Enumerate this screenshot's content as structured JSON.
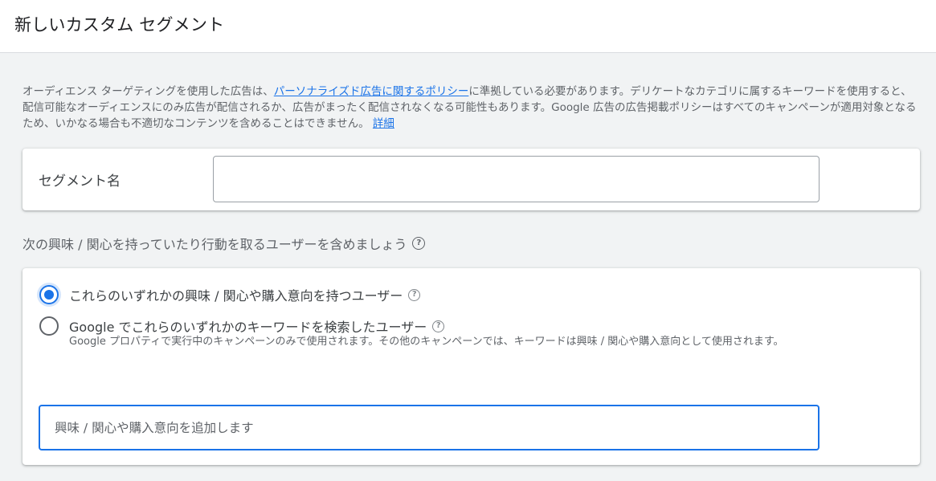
{
  "header": {
    "title": "新しいカスタム セグメント"
  },
  "policy": {
    "text_before": "オーディエンス ターゲティングを使用した広告は、",
    "link_policy": "パーソナライズド広告に関するポリシー",
    "text_after": "に準拠している必要があります。デリケートなカテゴリに属するキーワードを使用すると、配信可能なオーディエンスにのみ広告が配信されるか、広告がまったく配信されなくなる可能性もあります。Google 広告の広告掲載ポリシーはすべてのキャンペーンが適用対象となるため、いかなる場合も不適切なコンテンツを含めることはできません。",
    "link_details": "詳細"
  },
  "segment_name": {
    "label": "セグメント名",
    "value": "",
    "placeholder": ""
  },
  "section": {
    "label": "次の興味 / 関心を持っていたり行動を取るユーザーを含めましょう"
  },
  "options": [
    {
      "label": "これらのいずれかの興味 / 関心や購入意向を持つユーザー",
      "checked": true
    },
    {
      "label": "Google でこれらのいずれかのキーワードを検索したユーザー",
      "checked": false,
      "description": "Google プロパティで実行中のキャンペーンのみで使用されます。その他のキャンペーンでは、キーワードは興味 / 関心や購入意向として使用されます。"
    }
  ],
  "interest_input": {
    "value": "",
    "placeholder": "興味 / 関心や購入意向を追加します"
  },
  "icons": {
    "help": "help-circle-icon"
  },
  "colors": {
    "accent": "#1a73e8",
    "background": "#f1f3f4"
  }
}
